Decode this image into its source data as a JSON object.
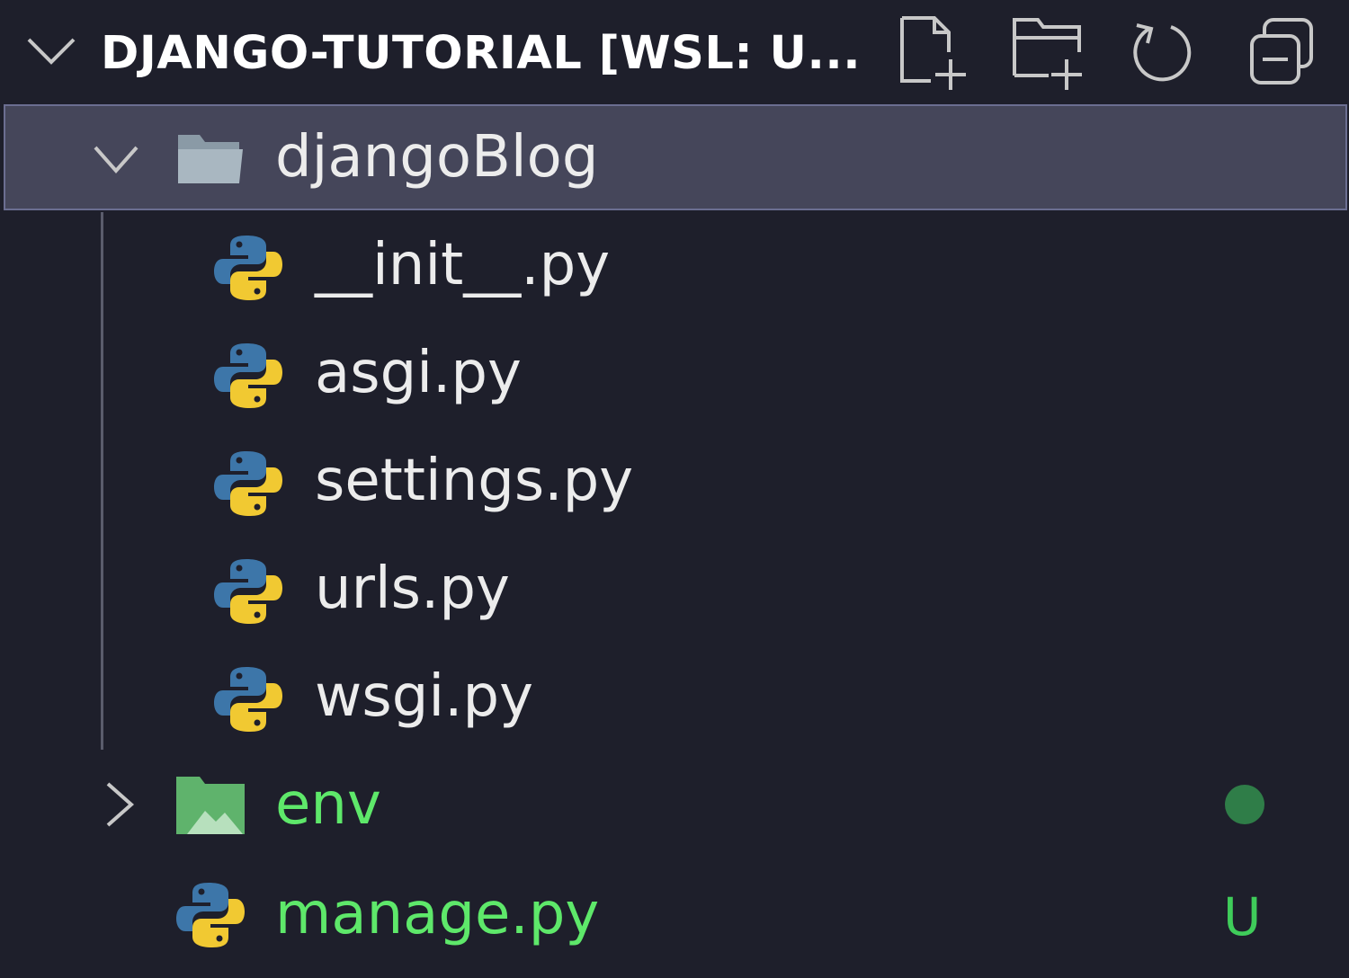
{
  "explorer": {
    "title": "DJANGO-TUTORIAL [WSL: U...",
    "actions": [
      {
        "name": "new-file-icon"
      },
      {
        "name": "new-folder-icon"
      },
      {
        "name": "refresh-icon"
      },
      {
        "name": "collapse-all-icon"
      }
    ]
  },
  "tree": {
    "folder_djangoBlog": "djangoBlog",
    "files": [
      "__init__.py",
      "asgi.py",
      "settings.py",
      "urls.py",
      "wsgi.py"
    ],
    "folder_env": "env",
    "file_manage": "manage.py",
    "manage_status": "U"
  },
  "colors": {
    "background": "#1e1f2b",
    "selected_row": "#45465a",
    "untracked_green": "#5ee86a",
    "status_dot": "#2f7d48",
    "python_blue": "#3d76a9",
    "python_yellow": "#f1c932"
  }
}
